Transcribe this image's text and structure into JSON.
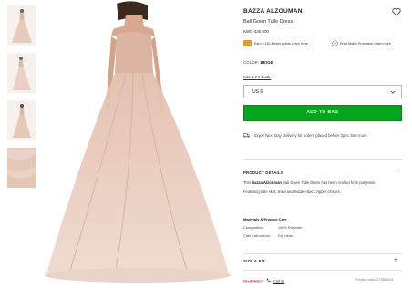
{
  "product": {
    "brand": "BAZZA ALZOUMAN",
    "name": "Ball Gown Tulle Dress",
    "price": "KWD 430.000"
  },
  "amber": {
    "text": "Earn 5,160 Amber points",
    "link": "Learn more"
  },
  "price_match": {
    "text": "Price Match Promotion",
    "link": "Learn more"
  },
  "color": {
    "label": "COLOR:",
    "value": "BEIGE"
  },
  "size_guide": "Size & Fit Guide",
  "size_select": {
    "value": "US 6"
  },
  "add_to_bag": "ADD TO BAG",
  "delivery": "Enjoy Next Day Delivery for orders placed before 2pm. See more",
  "product_details": {
    "heading": "PRODUCT DETAILS",
    "toggle": "−",
    "desc_prefix": "This",
    "desc_bold": "Bazza Alzouman",
    "desc_rest": "Ball Gown Tulle Dress has been crafted from polyester.",
    "desc_line2": "Featuring tulle skirt, lined and hidden-back zipper closure."
  },
  "materials": {
    "heading": "Materials & Product Care",
    "rows": [
      {
        "key": "Composition:",
        "value": "100% Polyester"
      },
      {
        "key": "Care Instructions:",
        "value": "Dry clean"
      }
    ]
  },
  "size_fit": {
    "heading": "SIZE & FIT",
    "toggle": "+"
  },
  "help": {
    "need": "Need Help?",
    "call": "Call Us"
  },
  "product_code": "Product code: 272983416",
  "colors": {
    "add_to_bag": "#05a51d",
    "amber_badge": "#e89a2c",
    "dress": "#e9cbbd"
  }
}
